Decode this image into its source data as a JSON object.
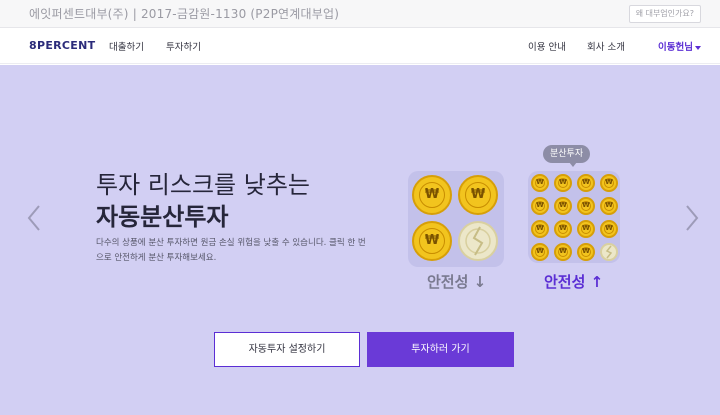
{
  "topbar": {
    "company": "에잇퍼센트대부(주) | 2017-금감원-1130 (P2P연계대부업)",
    "help": "왜 대부업인가요?"
  },
  "nav": {
    "logo": "8PERCENT",
    "links_left": [
      "대출하기",
      "투자하기"
    ],
    "links_right": [
      "이용 안내",
      "회사 소개"
    ],
    "user": "이동헌님"
  },
  "hero": {
    "headline_line1": "투자 리스크를 낮추는",
    "headline_line2": "자동분산투자",
    "description": "다수의 상품에 분산 투자하면 원금 손실 위험을 낮출 수 있습니다. 클릭 한 번으로 안전하게 분산 투자해보세요.",
    "badge": "분산투자",
    "safety_low": "안전성 ↓",
    "safety_high": "안전성 ↑",
    "coin_symbol": "₩",
    "button_auto": "자동투자 설정하기",
    "button_invest": "투자하러 가기"
  },
  "colors": {
    "hero_bg": "#d2cff3",
    "accent": "#6a3ad7",
    "coin": "#f2c41e"
  },
  "icons": {
    "prev": "chevron-left-icon",
    "next": "chevron-right-icon",
    "user_menu": "caret-down-icon"
  }
}
